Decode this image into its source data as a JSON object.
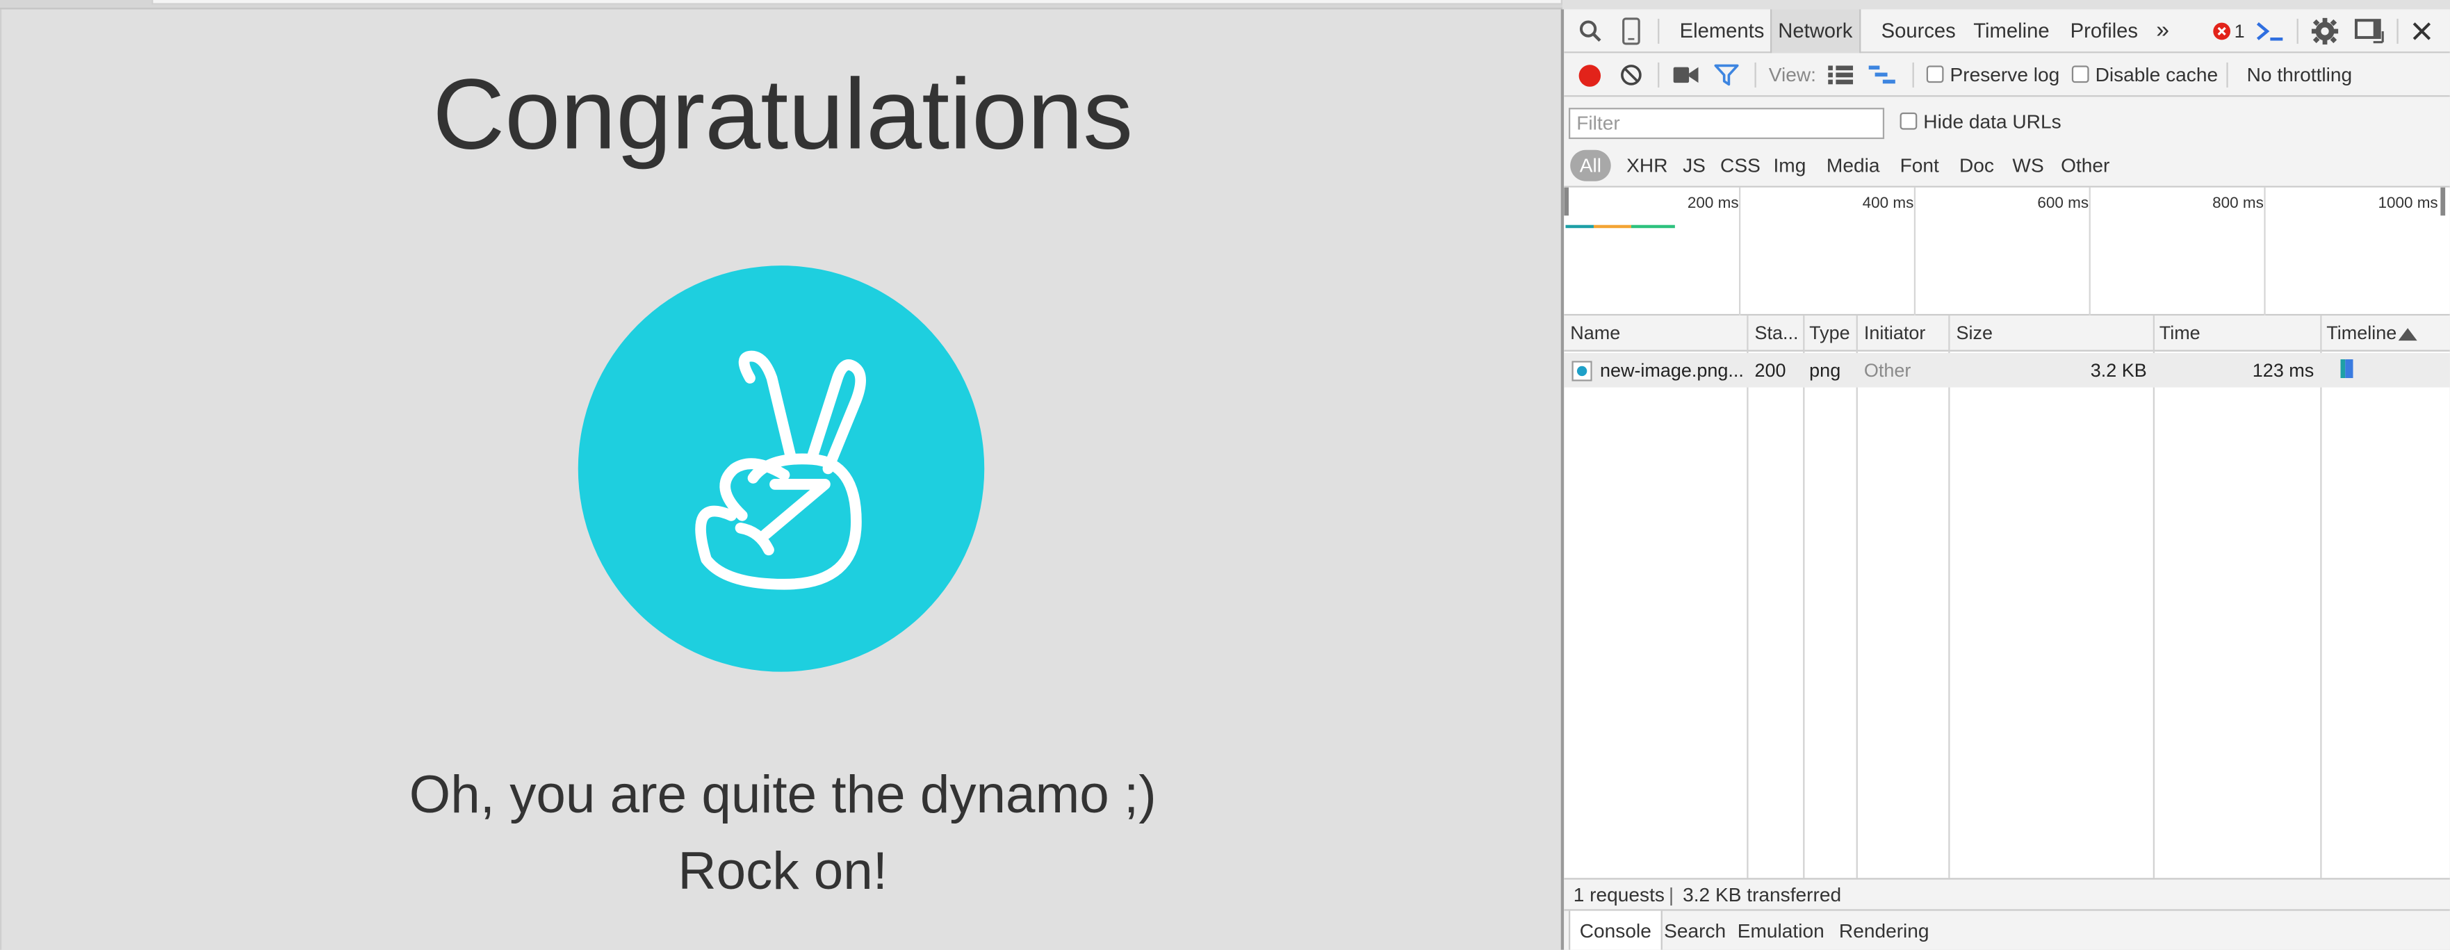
{
  "page": {
    "heading": "Congratulations",
    "line1": "Oh, you are quite the dynamo ;)",
    "line2": "Rock on!",
    "logo_icon": "peace-hand-icon",
    "logo_color": "#1ecfdf"
  },
  "devtools": {
    "tabs": [
      "Elements",
      "Network",
      "Sources",
      "Timeline",
      "Profiles"
    ],
    "active_tab": "Network",
    "more_tabs": "»",
    "error_count": "1",
    "toolbar": {
      "view_label": "View:",
      "preserve_log": "Preserve log",
      "disable_cache": "Disable cache",
      "throttling": "No throttling"
    },
    "filter": {
      "placeholder": "Filter",
      "hide_data_urls": "Hide data URLs",
      "types": [
        "All",
        "XHR",
        "JS",
        "CSS",
        "Img",
        "Media",
        "Font",
        "Doc",
        "WS",
        "Other"
      ],
      "active_type": "All"
    },
    "overview_ticks": [
      "200 ms",
      "400 ms",
      "600 ms",
      "800 ms",
      "1000 ms"
    ],
    "table": {
      "columns": [
        "Name",
        "Sta...",
        "Type",
        "Initiator",
        "Size",
        "Time",
        "Timeline"
      ],
      "rows": [
        {
          "name": "new-image.png...",
          "status": "200",
          "type": "png",
          "initiator": "Other",
          "size": "3.2 KB",
          "time": "123 ms"
        }
      ]
    },
    "summary": {
      "requests": "1 requests",
      "divider": "|",
      "transferred": "3.2 KB transferred"
    },
    "drawer_tabs": [
      "Console",
      "Search",
      "Emulation",
      "Rendering"
    ],
    "active_drawer_tab": "Console",
    "colors": {
      "record_red": "#e2231a",
      "filter_blue": "#3d85e0",
      "error_red": "#e2231a",
      "console_blue": "#2f6fe0",
      "waiting_teal": "#1ea0a6",
      "receiving_blue": "#3a7be0"
    }
  }
}
